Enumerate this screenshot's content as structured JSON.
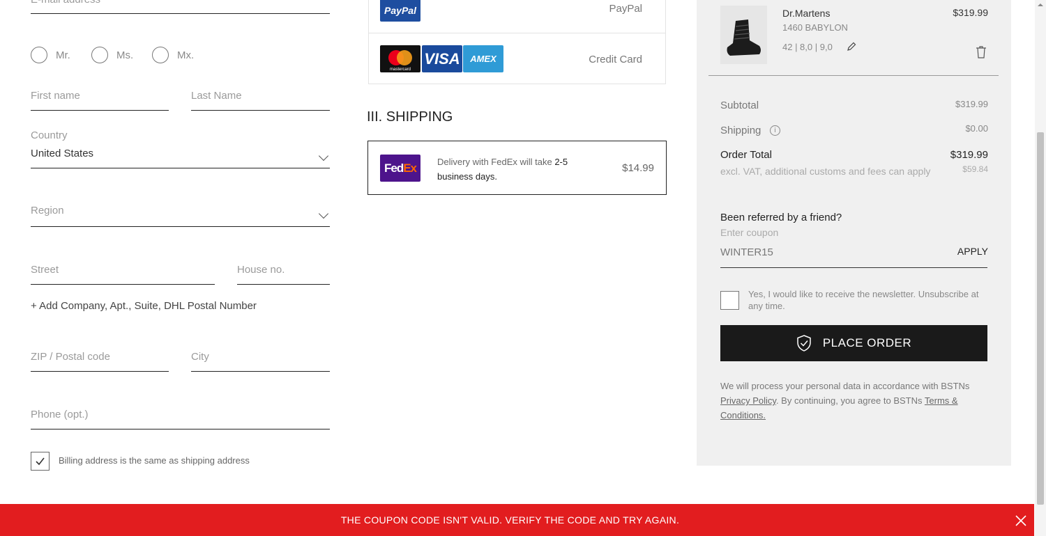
{
  "form": {
    "email_placeholder": "E-mail address",
    "salutations": [
      "Mr.",
      "Ms.",
      "Mx."
    ],
    "first_name_placeholder": "First name",
    "last_name_placeholder": "Last Name",
    "country_label": "Country",
    "country_value": "United States",
    "region_placeholder": "Region",
    "street_placeholder": "Street",
    "house_no_placeholder": "House no.",
    "add_company_link": "+ Add Company, Apt., Suite, DHL Postal Number",
    "zip_placeholder": "ZIP / Postal code",
    "city_placeholder": "City",
    "phone_placeholder": "Phone (opt.)",
    "billing_same_label": "Billing address is the same as shipping address",
    "billing_same_checked": true
  },
  "payment": {
    "paypal_logo": "PayPal",
    "paypal_label": "PayPal",
    "card_logos": [
      "mastercard",
      "VISA",
      "AMEX"
    ],
    "credit_card_label": "Credit Card"
  },
  "shipping": {
    "heading": "III. SHIPPING",
    "fedex_logo_fed": "Fed",
    "fedex_logo_ex": "Ex",
    "desc_prefix": "Delivery with FedEx will take ",
    "desc_days": "2-5",
    "desc_suffix": "business days.",
    "price": "$14.99"
  },
  "cart": {
    "item": {
      "brand": "Dr.Martens",
      "name": "1460 BABYLON",
      "sizes": "42 | 8,0 | 9,0",
      "price": "$319.99"
    },
    "subtotal_label": "Subtotal",
    "subtotal_value": "$319.99",
    "shipping_label": "Shipping",
    "shipping_value": "$0.00",
    "total_label": "Order Total",
    "total_value": "$319.99",
    "vat_note": "excl. VAT, additional customs and fees can apply",
    "vat_value": "$59.84",
    "referral_heading": "Been referred by a friend?",
    "coupon_placeholder": "Enter coupon",
    "coupon_value": "WINTER15",
    "apply_label": "APPLY",
    "newsletter_label": "Yes, I would like to receive the newsletter. Unsubscribe at any time.",
    "place_order_label": "PLACE ORDER",
    "privacy_prefix": "We will process your personal data in accordance with BSTNs ",
    "privacy_link": "Privacy Policy",
    "privacy_middle": ". By continuing, you agree to BSTNs ",
    "terms_link": "Terms & Conditions."
  },
  "banner": {
    "message": "THE COUPON CODE ISN'T VALID. VERIFY THE CODE AND TRY AGAIN."
  },
  "colors": {
    "banner": "#e21d1f",
    "place_order_bg": "#1a1a1a",
    "paypal_blue": "#1e4ea0",
    "visa_blue": "#1a4a9c",
    "amex_blue": "#2f9bd6",
    "fedex_purple": "#4d148c",
    "fedex_orange": "#ff6600",
    "panel_bg": "#f0f0f0"
  }
}
